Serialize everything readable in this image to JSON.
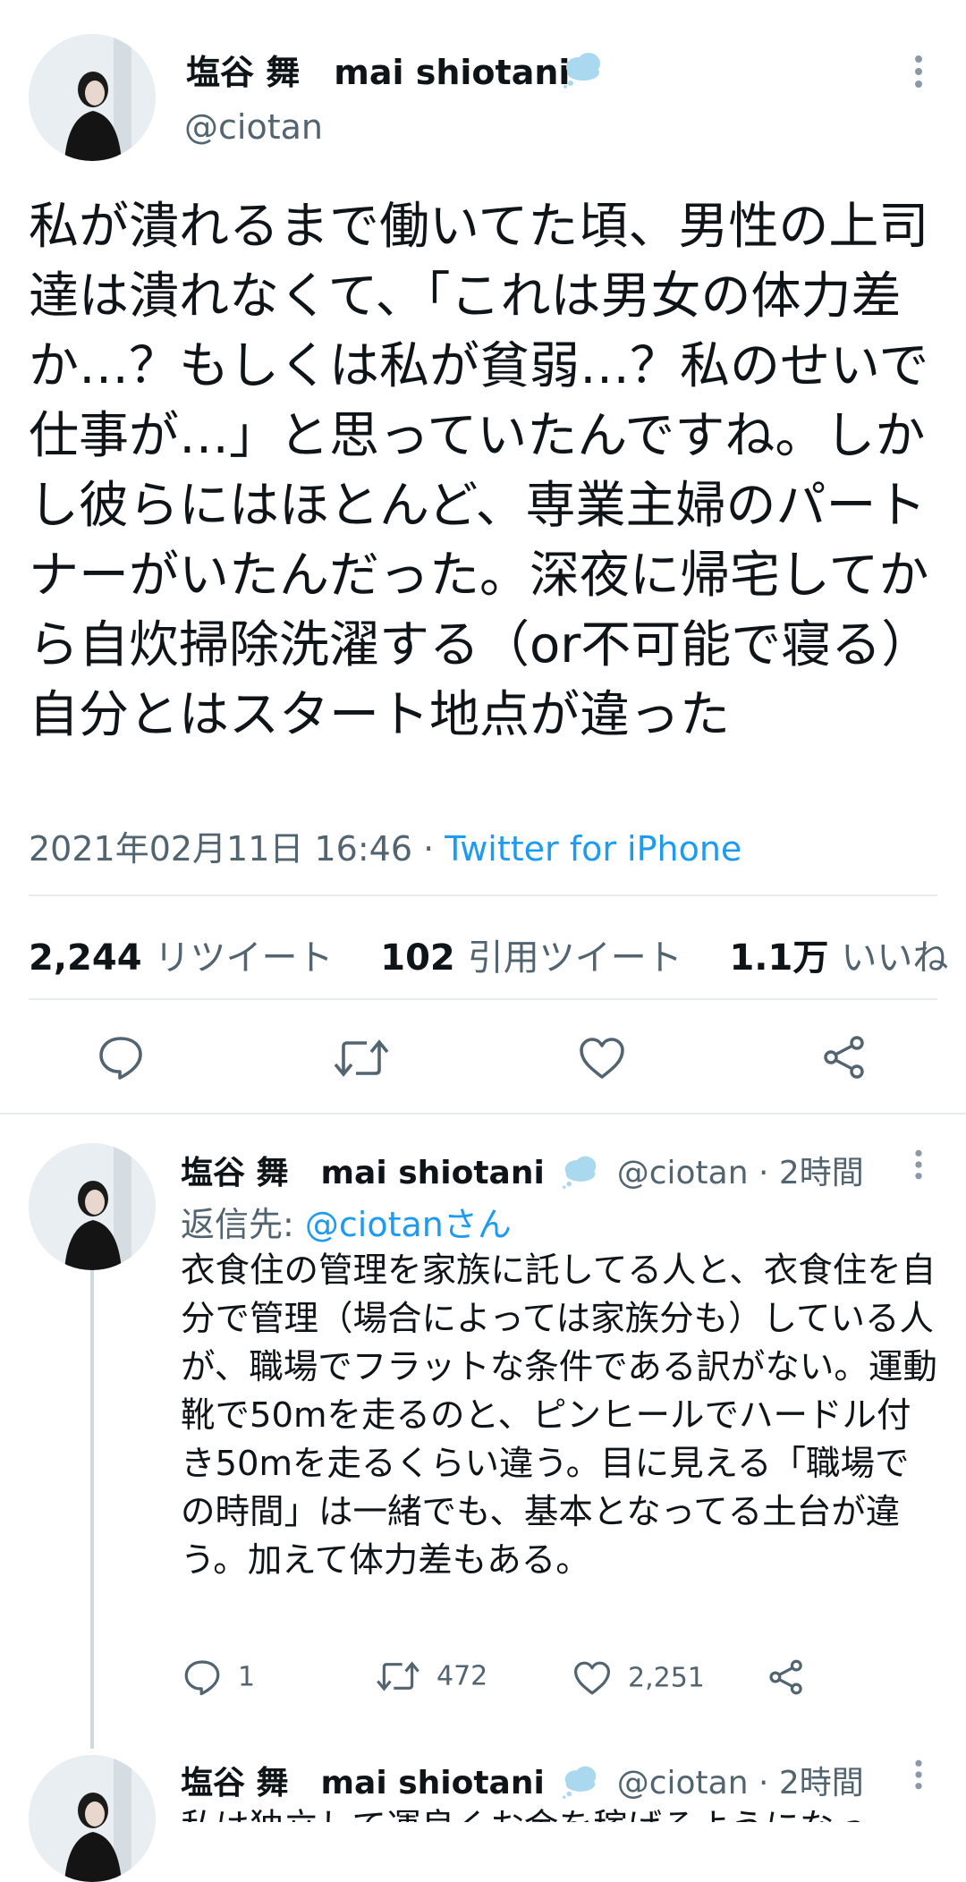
{
  "main_tweet": {
    "display_name": "塩谷 舞　mai shiotani",
    "handle": "@ciotan",
    "text": "私が潰れるまで働いてた頃、男性の上司達は潰れなくて、「これは男女の体力差か…？もしくは私が貧弱…？私のせいで仕事が…」と思っていたんですね。しかし彼らにはほとんど、専業主婦のパートナーがいたんだった。深夜に帰宅してから自炊掃除洗濯する（or不可能で寝る）自分とはスタート地点が違った",
    "timestamp": "2021年02月11日 16:46",
    "separator": " · ",
    "source": "Twitter for iPhone",
    "retweets_count": "2,244",
    "retweets_label": "リツイート",
    "quotes_count": "102",
    "quotes_label": "引用ツイート",
    "likes_count": "1.1万",
    "likes_label": "いいね",
    "icons": [
      "reply-icon",
      "retweet-icon",
      "like-icon",
      "share-icon",
      "more-icon",
      "verified-cloud-icon"
    ]
  },
  "reply_1": {
    "display_name": "塩谷 舞　mai shiotani",
    "handle": "@ciotan",
    "time": " · 2時間",
    "reply_to_label": "返信先: ",
    "reply_to_handle": "@ciotanさん",
    "text": "衣食住の管理を家族に託してる人と、衣食住を自分で管理（場合によっては家族分も）している人が、職場でフラットな条件である訳がない。運動靴で50mを走るのと、ピンヒールでハードル付き50mを走るくらい違う。目に見える「職場での時間」は一緒でも、基本となってる土台が違う。加えて体力差もある。",
    "reply_count": "1",
    "retweet_count": "472",
    "like_count": "2,251"
  },
  "reply_2": {
    "display_name": "塩谷 舞　mai shiotani",
    "handle": "@ciotan",
    "time": " · 2時間",
    "text_partial": "私は独立して運良くお金を稼げるようになっ"
  },
  "colors": {
    "text": "#0f1419",
    "secondary": "#536471",
    "link": "#1d9bf0",
    "divider": "#e7ebee",
    "verified_cloud": "#a9d8ef"
  }
}
